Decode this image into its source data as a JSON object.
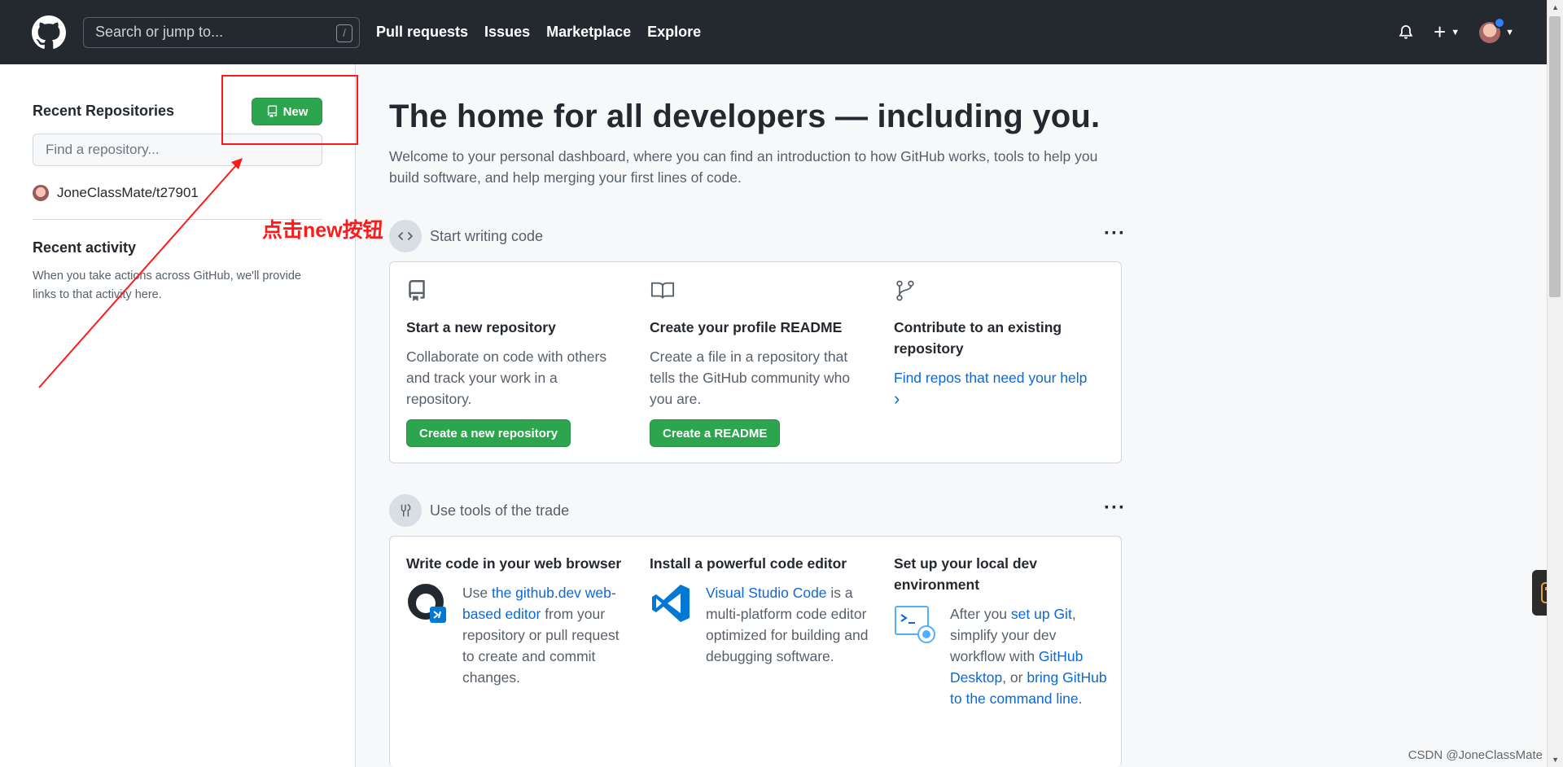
{
  "header": {
    "search_placeholder": "Search or jump to...",
    "search_shortcut": "/",
    "nav": [
      "Pull requests",
      "Issues",
      "Marketplace",
      "Explore"
    ],
    "plus": "+"
  },
  "sidebar": {
    "recent_title": "Recent Repositories",
    "new_button": "New",
    "find_placeholder": "Find a repository...",
    "repos": [
      "JoneClassMate/t27901"
    ],
    "activity_title": "Recent activity",
    "activity_text": "When you take actions across GitHub, we'll provide links to that activity here."
  },
  "annotation": {
    "text": "点击new按钮",
    "color": "#ff1a1a"
  },
  "main": {
    "title": "The home for all developers — including you.",
    "subtitle": "Welcome to your personal dashboard, where you can find an introduction to how GitHub works, tools to help you build software, and help merging your first lines of code.",
    "section1": {
      "label": "Start writing code",
      "icon": "code-icon",
      "cols": [
        {
          "icon": "repo-icon",
          "title": "Start a new repository",
          "text": "Collaborate on code with others and track your work in a repository.",
          "button": "Create a new repository"
        },
        {
          "icon": "book-icon",
          "title": "Create your profile README",
          "text": "Create a file in a repository that tells the GitHub community who you are.",
          "button": "Create a README"
        },
        {
          "icon": "git-branch-icon",
          "title": "Contribute to an existing repository",
          "link": "Find repos that need your help",
          "chevron": "›"
        }
      ]
    },
    "section2": {
      "label": "Use tools of the trade",
      "icon": "tools-icon",
      "cols": [
        {
          "title": "Write code in your web browser",
          "t1": "Use ",
          "l1": "the github.dev web-based editor",
          "t2": " from your repository or pull request to create and commit changes."
        },
        {
          "title": "Install a powerful code editor",
          "l1": "Visual Studio Code",
          "t1": " is a multi-platform code editor optimized for building and debugging software."
        },
        {
          "title": "Set up your local dev environment",
          "t1": "After you ",
          "l1": "set up Git",
          "t2": ", simplify your dev workflow with ",
          "l2": "GitHub Desktop",
          "t3": ", or ",
          "l3": "bring GitHub to the command line",
          "t4": "."
        }
      ]
    },
    "more": "···"
  },
  "watermark": "CSDN @JoneClassMate",
  "colors": {
    "header": "#24292f",
    "green": "#2da44e",
    "link": "#0969da"
  }
}
